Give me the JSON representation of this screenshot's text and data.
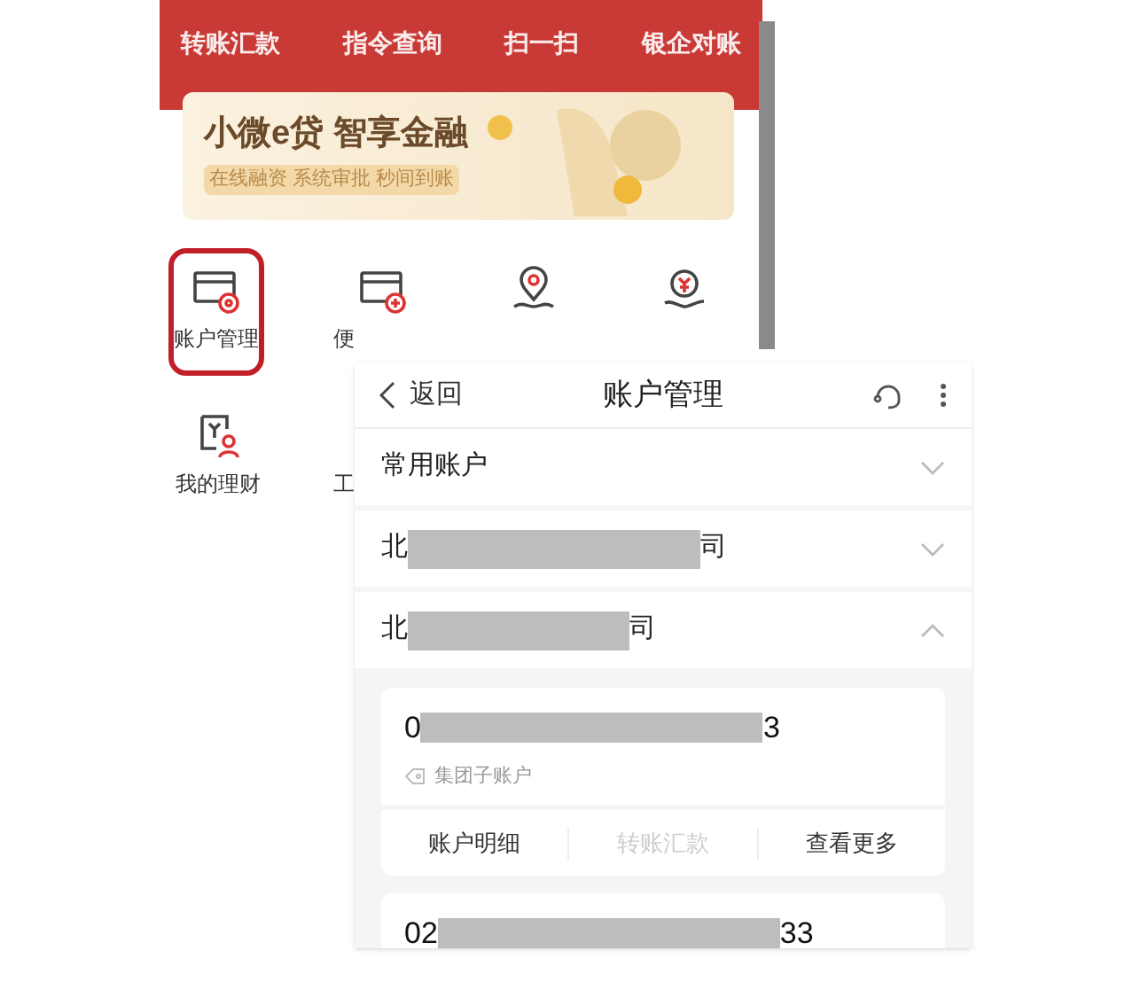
{
  "home_screen": {
    "top_nav": [
      "转账汇款",
      "指令查询",
      "扫一扫",
      "银企对账"
    ],
    "banner": {
      "title": "小微e贷 智享金融",
      "subtitle": "在线融资 系统审批 秒间到账"
    },
    "grid": [
      {
        "label": "账户管理",
        "highlighted": true
      },
      {
        "label": "便",
        "highlighted": false
      },
      {
        "highlighted": false
      },
      {
        "highlighted": false
      },
      {
        "label": "我的理财",
        "highlighted": false
      },
      {
        "label": "工",
        "highlighted": false
      }
    ]
  },
  "account_screen": {
    "back": "返回",
    "title": "账户管理",
    "sections": [
      {
        "title_start": "常用账户",
        "redacted": false,
        "expanded": false
      },
      {
        "title_start": "北",
        "title_end": "司",
        "redacted": true,
        "expanded": false
      },
      {
        "title_start": "北",
        "title_end": "司",
        "redacted": true,
        "expanded": true
      }
    ],
    "accounts": [
      {
        "number_start": "0",
        "number_end": "3",
        "tag": "集团子账户",
        "actions": [
          {
            "label": "账户明细",
            "disabled": false
          },
          {
            "label": "转账汇款",
            "disabled": true
          },
          {
            "label": "查看更多",
            "disabled": false
          }
        ]
      },
      {
        "number_start": "02",
        "number_end": "33"
      }
    ]
  }
}
